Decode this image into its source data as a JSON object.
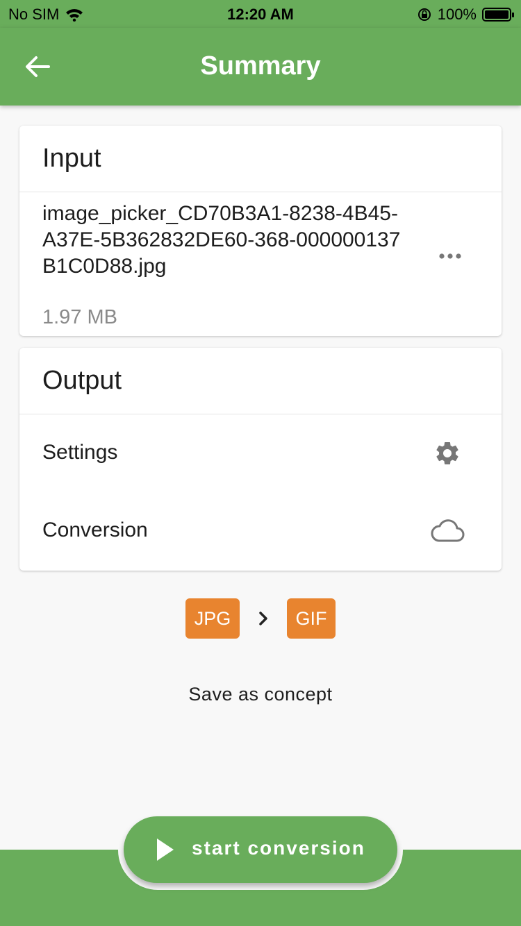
{
  "status_bar": {
    "carrier": "No SIM",
    "time": "12:20 AM",
    "battery": "100%"
  },
  "header": {
    "title": "Summary"
  },
  "input": {
    "title": "Input",
    "file_name": "image_picker_CD70B3A1-8238-4B45-A37E-5B362832DE60-368-000000137B1C0D88.jpg",
    "file_size": "1.97 MB"
  },
  "output": {
    "title": "Output",
    "settings_label": "Settings",
    "conversion_label": "Conversion"
  },
  "conversion": {
    "from": "JPG",
    "to": "GIF"
  },
  "save_concept_label": "Save as concept",
  "fab": {
    "label": "start conversion"
  },
  "colors": {
    "primary": "#69ad5b",
    "accent": "#e8842f",
    "background": "#f8f8f8"
  },
  "icons": [
    "wifi-icon",
    "rotation-lock-icon",
    "battery-icon",
    "back-arrow-icon",
    "more-horizontal-icon",
    "gear-icon",
    "cloud-icon",
    "chevron-right-icon",
    "play-icon"
  ]
}
